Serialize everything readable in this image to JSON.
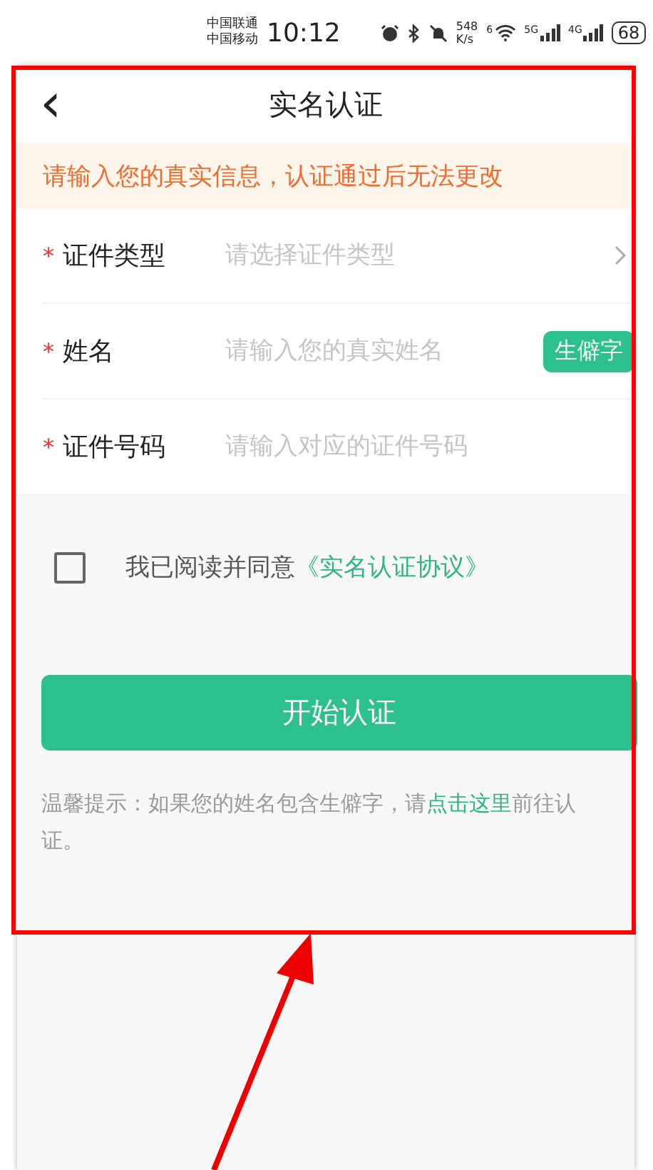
{
  "status_bar": {
    "carriers": [
      "中国联通",
      "中国移动"
    ],
    "time": "10:12",
    "net_speed": [
      "548",
      "K/s"
    ],
    "wifi_label": "6",
    "signals": [
      "5G",
      "4G"
    ],
    "battery": "68"
  },
  "header": {
    "back": "‹",
    "title": "实名认证"
  },
  "notice": "请输入您的真实信息，认证通过后无法更改",
  "fields": [
    {
      "kind": "select",
      "required_mark": "*",
      "label": "证件类型",
      "placeholder": "请选择证件类型"
    },
    {
      "kind": "name",
      "required_mark": "*",
      "label": "姓名",
      "placeholder": "请输入您的真实姓名",
      "badge": "生僻字"
    },
    {
      "kind": "text",
      "required_mark": "*",
      "label": "证件号码",
      "placeholder": "请输入对应的证件号码"
    }
  ],
  "agreement": {
    "checked": false,
    "text": "我已阅读并同意",
    "link": "《实名认证协议》"
  },
  "submit": "开始认证",
  "tip": {
    "before": "温馨提示：如果您的姓名包含生僻字，请",
    "link": "点击这里",
    "after": "前往认证。"
  }
}
